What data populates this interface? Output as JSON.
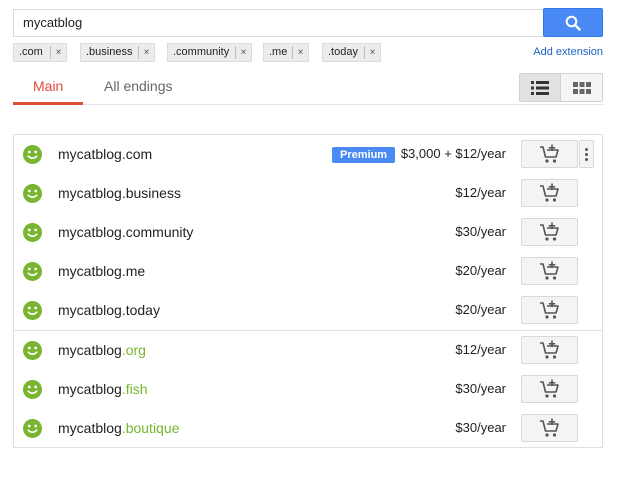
{
  "search": {
    "value": "mycatblog"
  },
  "chips": [
    {
      "label": ".com"
    },
    {
      "label": ".business"
    },
    {
      "label": ".community"
    },
    {
      "label": ".me"
    },
    {
      "label": ".today"
    }
  ],
  "chip_remove_label": "×",
  "add_extension_label": "Add extension",
  "tabs": [
    {
      "label": "Main",
      "active": true
    },
    {
      "label": "All endings",
      "active": false
    }
  ],
  "view_mode": "list",
  "results": {
    "premium_label": "Premium",
    "rows": [
      {
        "name": "mycatblog",
        "tld": ".com",
        "tld_highlight": false,
        "price": "$3,000 + $12/year",
        "premium": true,
        "status": "available"
      },
      {
        "name": "mycatblog",
        "tld": ".business",
        "tld_highlight": false,
        "price": "$12/year",
        "premium": false,
        "status": "available"
      },
      {
        "name": "mycatblog",
        "tld": ".community",
        "tld_highlight": false,
        "price": "$30/year",
        "premium": false,
        "status": "available"
      },
      {
        "name": "mycatblog",
        "tld": ".me",
        "tld_highlight": false,
        "price": "$20/year",
        "premium": false,
        "status": "available"
      },
      {
        "name": "mycatblog",
        "tld": ".today",
        "tld_highlight": false,
        "price": "$20/year",
        "premium": false,
        "status": "available"
      },
      {
        "name": "mycatblog",
        "tld": ".org",
        "tld_highlight": true,
        "price": "$12/year",
        "premium": false,
        "status": "available"
      },
      {
        "name": "mycatblog",
        "tld": ".fish",
        "tld_highlight": true,
        "price": "$30/year",
        "premium": false,
        "status": "available"
      },
      {
        "name": "mycatblog",
        "tld": ".boutique",
        "tld_highlight": true,
        "price": "$30/year",
        "premium": false,
        "status": "available"
      }
    ]
  },
  "colors": {
    "accent_red": "#dd4b39",
    "search_blue": "#4a8af4",
    "available_green": "#79b530",
    "link_blue": "#1a62c7"
  },
  "icons": {
    "search": "search-icon",
    "list_view": "list-view-icon",
    "grid_view": "grid-view-icon",
    "available": "smiley-icon",
    "add_to_cart": "add-to-cart-icon",
    "more": "more-vert-icon"
  }
}
